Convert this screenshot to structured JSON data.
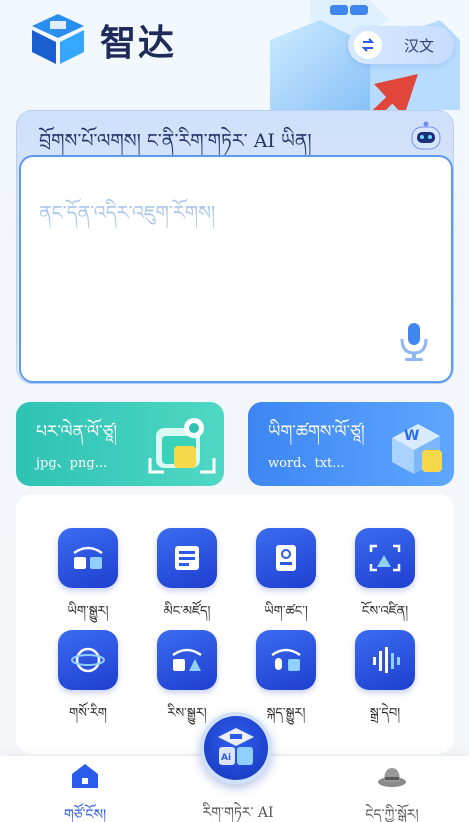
{
  "header": {
    "app_name": "智达",
    "language_toggle": "汉文"
  },
  "translator": {
    "title": "བྲོགས་པོ་ལགས། ང་ནི་རིག་གཏེར་ AI ཡིན།",
    "placeholder": "ནང་དོན་འདིར་འཇུག་རོགས།"
  },
  "features": [
    {
      "title": "པར་ལེན་ལོ་ཙཱ།",
      "subtitle": "jpg、png..."
    },
    {
      "title": "ཡིག་ཚགས་ལོ་ཙཱ།",
      "subtitle": "word、txt..."
    }
  ],
  "tools": [
    {
      "label": "ཡིག་སྒྱུར།",
      "icon": "translate-icon"
    },
    {
      "label": "མིང་མཛོད།",
      "icon": "book-icon"
    },
    {
      "label": "ཡིག་ཚང་།",
      "icon": "document-icon"
    },
    {
      "label": "ངོས་འཛིན།",
      "icon": "scan-icon"
    },
    {
      "label": "གསོ་རིག",
      "icon": "globe-icon"
    },
    {
      "label": "རིས་སྒྱུར།",
      "icon": "image-convert-icon"
    },
    {
      "label": "སྐད་སྒྱུར།",
      "icon": "voice-translate-icon"
    },
    {
      "label": "སྒྲ་དེབ།",
      "icon": "audio-book-icon"
    }
  ],
  "nav": {
    "home": "གཙོ་ངོས།",
    "ai": "རིག་གཏེར་ AI",
    "me": "ངེད་ཀྱི་སྒོར།"
  },
  "colors": {
    "accent": "#2a5bea",
    "teal": "#2ec2b4",
    "arrow": "#e0473a"
  }
}
